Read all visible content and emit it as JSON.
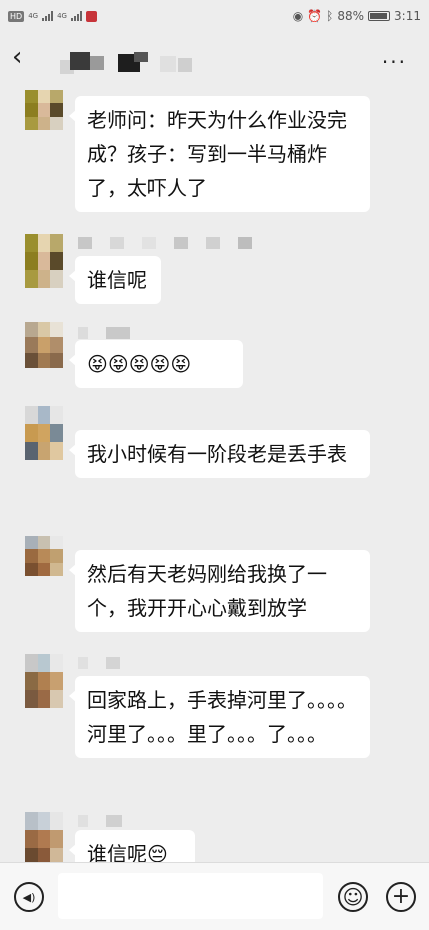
{
  "status_bar": {
    "network_tag": "HD",
    "network_label": "4G",
    "battery_percent": "88%",
    "time": "3:11"
  },
  "header": {
    "back_icon": "chevron-left-icon",
    "more_icon": "more-dots-icon",
    "more_label": "···"
  },
  "messages": [
    {
      "text": "老师问：昨天为什么作业没完成？孩子：写到一半马桶炸了，太吓人了"
    },
    {
      "text": "谁信呢"
    },
    {
      "text": "😝😝😝😝😝"
    },
    {
      "text": "我小时候有一阶段老是丢手表"
    },
    {
      "text": "然后有天老妈刚给我换了一个，我开开心心戴到放学"
    },
    {
      "text": "回家路上，手表掉河里了。。。。河里了。。。里了。。。了。。。"
    },
    {
      "text": "谁信呢😔"
    }
  ],
  "input_bar": {
    "voice_icon": "voice-icon",
    "emoji_icon": "emoji-icon",
    "add_icon": "add-icon",
    "voice_glyph": "◀)",
    "emoji_glyph": "☺",
    "add_glyph": "+"
  },
  "colors": {
    "background": "#ededed",
    "bubble": "#ffffff",
    "input_bar": "#f7f7f7"
  }
}
